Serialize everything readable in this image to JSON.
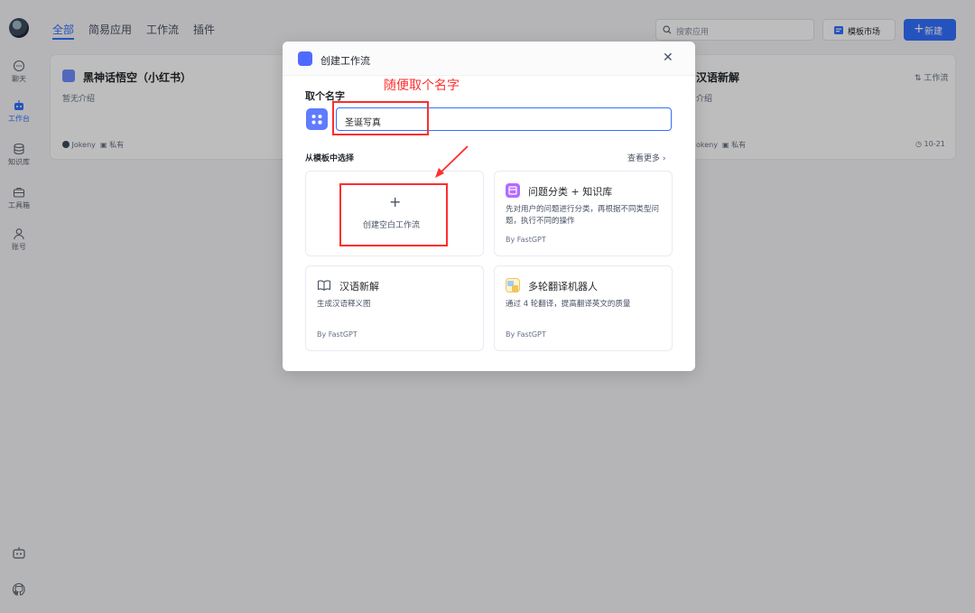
{
  "tabs": [
    "全部",
    "简易应用",
    "工作流",
    "插件"
  ],
  "sidebar": {
    "items": [
      {
        "label": "聊天",
        "icon": "chat-icon"
      },
      {
        "label": "工作台",
        "icon": "robot-icon"
      },
      {
        "label": "知识库",
        "icon": "database-icon"
      },
      {
        "label": "工具箱",
        "icon": "toolbox-icon"
      },
      {
        "label": "账号",
        "icon": "user-icon"
      }
    ],
    "bottom": [
      "robot-icon",
      "github-icon"
    ]
  },
  "header": {
    "search_placeholder": "搜索应用",
    "market_label": "模板市场",
    "new_label": "新建"
  },
  "bg_cards": [
    {
      "title": "黑神话悟空（小红书）",
      "desc": "暂无介绍",
      "owner": "Jokeny",
      "visibility": "私有"
    },
    {
      "title": "汉语新解",
      "desc": "介绍",
      "owner": "okeny",
      "visibility": "私有",
      "badge": "工作流",
      "date": "10-21"
    }
  ],
  "modal": {
    "title": "创建工作流",
    "name_label": "取个名字",
    "name_value": "圣诞写真",
    "annotation": "随便取个名字",
    "template_label": "从模板中选择",
    "more_label": "查看更多",
    "blank_label": "创建空白工作流",
    "templates": [
      {
        "name": "问题分类 + 知识库",
        "desc": "先对用户的问题进行分类，再根据不同类型问题，执行不同的操作",
        "by": "By FastGPT",
        "color": "#b56bff"
      },
      {
        "name": "汉语新解",
        "desc": "生成汉语释义图",
        "by": "By FastGPT",
        "color": "#485264"
      },
      {
        "name": "多轮翻译机器人",
        "desc": "通过 4 轮翻译，提高翻译英文的质量",
        "by": "By FastGPT",
        "color": "#f0c55a"
      }
    ]
  }
}
